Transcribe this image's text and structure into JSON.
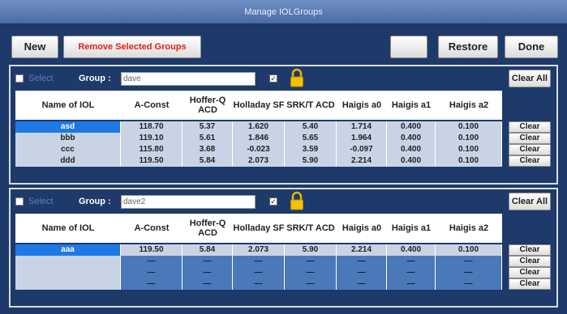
{
  "window": {
    "title": "Manage IOLGroups"
  },
  "toolbar": {
    "new_label": "New",
    "remove_label": "Remove Selected Groups",
    "restore_label": "Restore",
    "done_label": "Done"
  },
  "columns": [
    "Name of IOL",
    "A-Const",
    "Hoffer-Q ACD",
    "Holladay SF",
    "SRK/T ACD",
    "Haigis a0",
    "Haigis a1",
    "Haigis a2"
  ],
  "groups": [
    {
      "select_label": "Select",
      "group_label": "Group :",
      "group_name": "dave",
      "clear_all_label": "Clear All",
      "rows": [
        {
          "name": "asd",
          "values": [
            "118.70",
            "5.37",
            "1.620",
            "5.40",
            "1.714",
            "0.400",
            "0.100"
          ],
          "clear_label": "Clear"
        },
        {
          "name": "bbb",
          "values": [
            "119.10",
            "5.61",
            "1.846",
            "5.65",
            "1.964",
            "0.400",
            "0.100"
          ],
          "clear_label": "Clear"
        },
        {
          "name": "ccc",
          "values": [
            "115.80",
            "3.68",
            "-0.023",
            "3.59",
            "-0.097",
            "0.400",
            "0.100"
          ],
          "clear_label": "Clear"
        },
        {
          "name": "ddd",
          "values": [
            "119.50",
            "5.84",
            "2.073",
            "5.90",
            "2.214",
            "0.400",
            "0.100"
          ],
          "clear_label": "Clear"
        }
      ]
    },
    {
      "select_label": "Select",
      "group_label": "Group :",
      "group_name": "dave2",
      "clear_all_label": "Clear All",
      "rows": [
        {
          "name": "aaa",
          "values": [
            "119.50",
            "5.84",
            "2.073",
            "5.90",
            "2.214",
            "0.400",
            "0.100"
          ],
          "clear_label": "Clear"
        },
        {
          "name": "",
          "values": [
            "—",
            "—",
            "—",
            "—",
            "—",
            "—",
            "—"
          ],
          "clear_label": "Clear"
        },
        {
          "name": "",
          "values": [
            "—",
            "—",
            "—",
            "—",
            "—",
            "—",
            "—"
          ],
          "clear_label": "Clear"
        },
        {
          "name": "",
          "values": [
            "—",
            "—",
            "—",
            "—",
            "—",
            "—",
            "—"
          ],
          "clear_label": "Clear"
        }
      ]
    }
  ]
}
